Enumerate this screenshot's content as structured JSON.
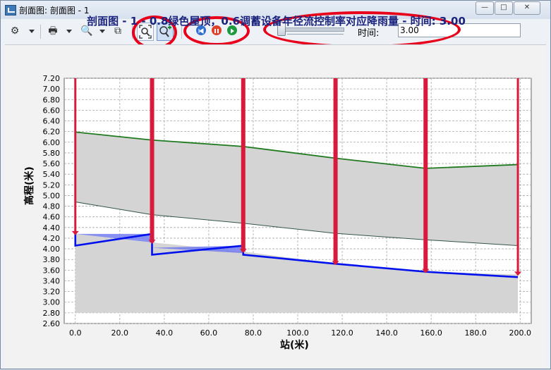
{
  "window": {
    "title": "剖面图: 剖面图 - 1",
    "controls": [
      "—",
      "□",
      "✕"
    ]
  },
  "toolbar": {
    "time_label": "时间:",
    "time_value": "3.00",
    "slider_value": 0
  },
  "icons": {
    "settings": "gear-icon",
    "print": "printer-icon",
    "preview": "print-preview-icon",
    "copy": "copy-icon",
    "zoom_extents": "zoom-extents-icon",
    "zoom_in": "zoom-in-icon",
    "rewind": "rewind-icon",
    "pause": "pause-icon",
    "play": "play-icon"
  },
  "colors": {
    "title": "#1a237e",
    "ground_line": "#1f7a1f",
    "water_line": "#0011ee",
    "manhole": "#d81b3d",
    "fill_gray": "#d4d4d4",
    "water_fill": "#6a74ee",
    "highlight_circle": "#e8001b"
  },
  "chart_data": {
    "type": "line",
    "title": "剖面图 - 1 - 0.8绿色屋顶，0.6调蓄设备年径流控制率对应降雨量 - 时间: 3.00",
    "xlabel": "站(米)",
    "ylabel": "高程(米)",
    "xlim": [
      -5,
      205
    ],
    "ylim": [
      2.6,
      7.2
    ],
    "grid": true,
    "xticks": [
      "0.0",
      "20.0",
      "40.0",
      "60.0",
      "80.0",
      "100.0",
      "120.0",
      "140.0",
      "160.0",
      "180.0",
      "200.0"
    ],
    "yticks": [
      "2.60",
      "2.80",
      "3.00",
      "3.20",
      "3.40",
      "3.60",
      "3.80",
      "4.00",
      "4.20",
      "4.40",
      "4.60",
      "4.80",
      "5.00",
      "5.20",
      "5.40",
      "5.60",
      "5.80",
      "6.00",
      "6.20",
      "6.40",
      "6.60",
      "6.80",
      "7.00",
      "7.20"
    ],
    "series": [
      {
        "x": [
          0.0,
          34.5,
          75.5,
          117.0,
          157.5,
          199.0
        ],
        "values": [
          6.19,
          6.04,
          5.92,
          5.7,
          5.51,
          5.58
        ]
      },
      {
        "x": [
          0.0,
          34.5,
          75.5,
          117.0,
          157.5,
          199.0
        ],
        "values": [
          4.88,
          4.64,
          4.48,
          4.29,
          4.17,
          4.06
        ]
      },
      {
        "x": [
          0.0,
          0.0,
          34.5,
          34.5,
          75.5,
          75.5,
          117.0,
          157.5,
          199.0
        ],
        "values": [
          4.28,
          4.06,
          4.28,
          3.89,
          4.06,
          3.89,
          3.72,
          3.57,
          3.47
        ]
      }
    ],
    "manholes": [
      {
        "x": 0.0,
        "invert": 4.28
      },
      {
        "x": 34.5,
        "invert": 4.12
      },
      {
        "x": 75.5,
        "invert": 3.95
      },
      {
        "x": 117.0,
        "invert": 3.72
      },
      {
        "x": 157.5,
        "invert": 3.57
      },
      {
        "x": 199.0,
        "invert": 3.52
      }
    ],
    "bottom": 2.8,
    "top": 7.2
  }
}
